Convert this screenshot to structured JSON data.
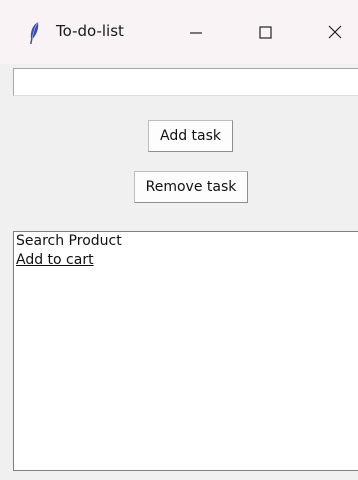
{
  "window": {
    "title": "To-do-list",
    "icons": {
      "app": "feather-icon",
      "minimize": "minimize-icon",
      "maximize": "maximize-icon",
      "close": "close-icon"
    }
  },
  "task_entry": {
    "value": "",
    "placeholder": ""
  },
  "buttons": {
    "add_label": "Add task",
    "remove_label": "Remove task"
  },
  "task_list": {
    "items": [
      {
        "label": "Search Product",
        "active": false
      },
      {
        "label": "Add to cart",
        "active": true
      }
    ]
  }
}
